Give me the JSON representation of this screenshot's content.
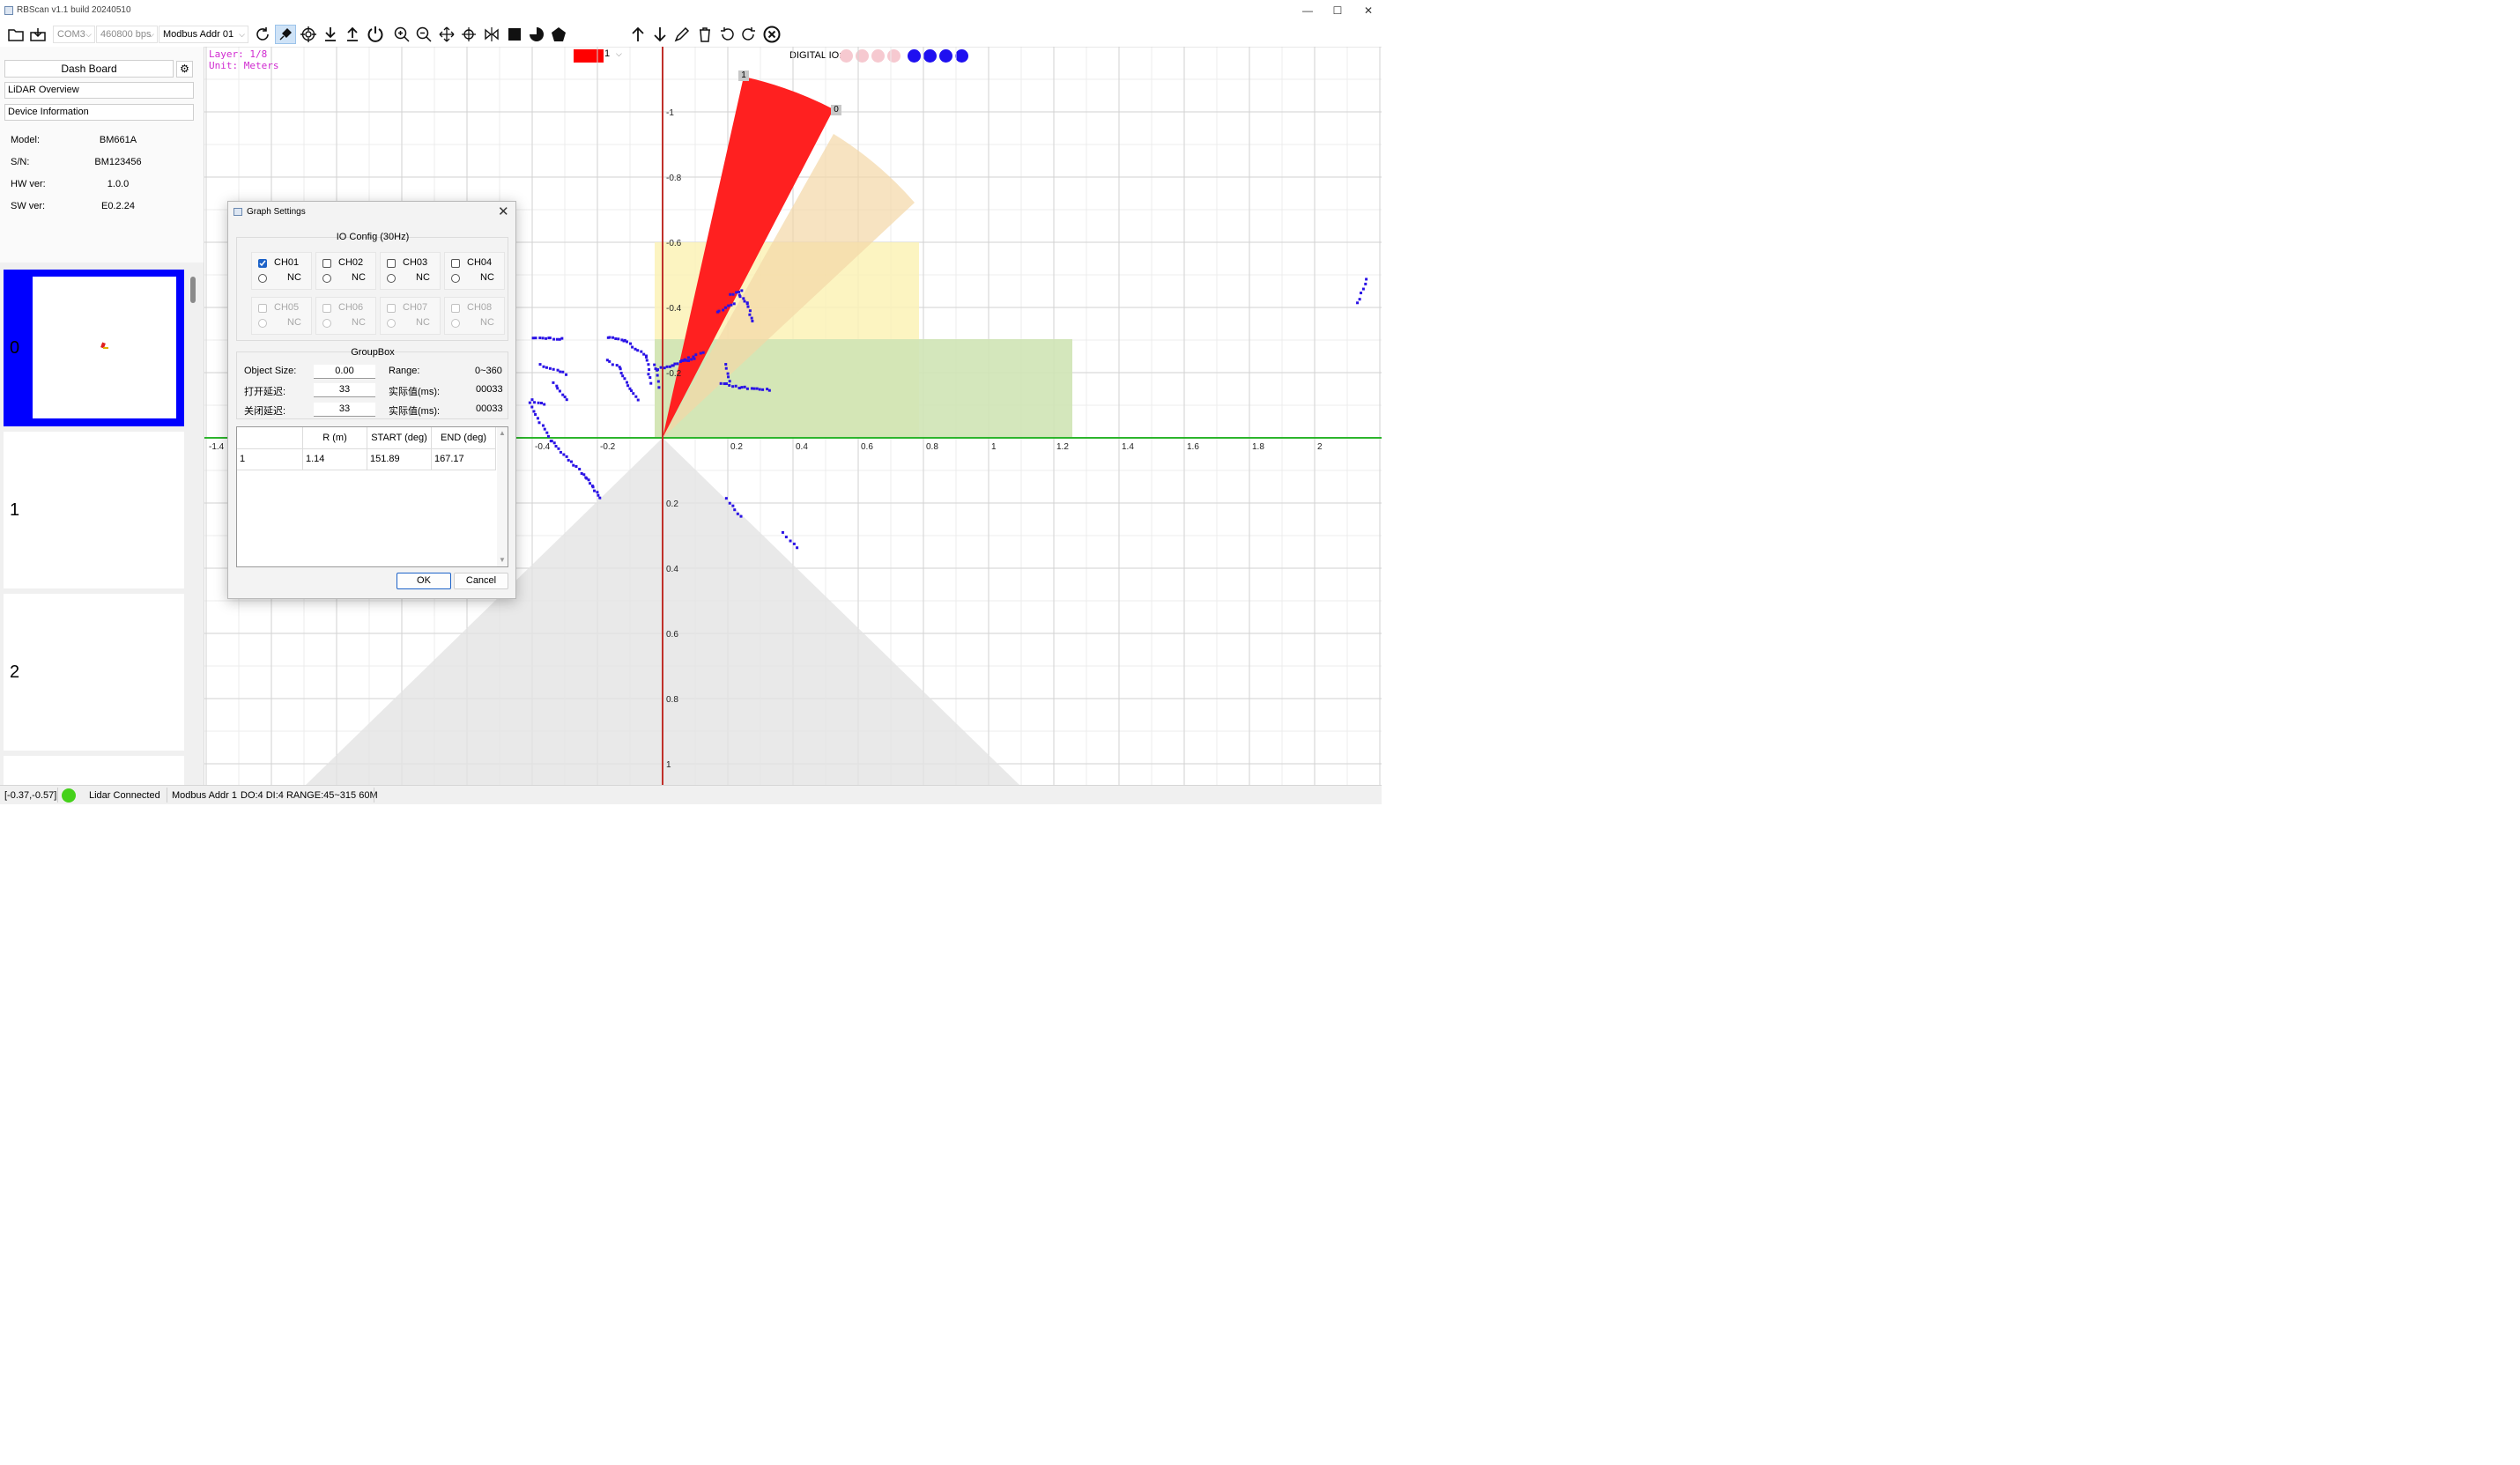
{
  "window": {
    "title": "RBScan v1.1 build 20240510",
    "minimize": "—",
    "maximize": "☐",
    "close": "✕"
  },
  "toolbar": {
    "com_port": "COM3",
    "baud_rate": "460800 bps",
    "modbus_addr": "Modbus Addr 01",
    "color_select_value": "1",
    "digital_io_label": "DIGITAL IO:",
    "digital_io_leds": [
      "off",
      "off",
      "off",
      "off",
      "on",
      "on",
      "on",
      "on"
    ],
    "colors": {
      "led_off": "#f6c9d0",
      "led_on": "#1f10f0",
      "swatch": "#ff0000",
      "accent": "#1c62c8"
    }
  },
  "sidebar": {
    "dashboard": "Dash Board",
    "lidar_overview": "LiDAR Overview",
    "device_info": "Device Information",
    "info": [
      {
        "label": "Model:",
        "value": "BM661A"
      },
      {
        "label": "S/N:",
        "value": "BM123456"
      },
      {
        "label": "HW ver:",
        "value": "1.0.0"
      },
      {
        "label": "SW ver:",
        "value": "E0.2.24"
      }
    ],
    "layers": [
      "0",
      "1",
      "2"
    ]
  },
  "canvas": {
    "layer_label": "Layer: 1/8",
    "unit_label": "Unit: Meters",
    "zone_label_1": "1",
    "zone_label_0": "0",
    "x_ticks": [
      "-1.4",
      "-0.4",
      "-0.2",
      "0.2",
      "0.4",
      "0.6",
      "0.8",
      "1",
      "1.2",
      "1.4",
      "1.6",
      "1.8",
      "2"
    ],
    "y_ticks": [
      "-1",
      "-0.8",
      "-0.6",
      "-0.4",
      "-0.2",
      "0.2",
      "0.4",
      "0.6",
      "0.8",
      "1"
    ],
    "colors": {
      "axis_x": "#2db52d",
      "axis_y": "#c0302a",
      "points": "#2a12e6",
      "zone_red": "#ff2020"
    }
  },
  "dialog": {
    "title": "Graph Settings",
    "io_group_title": "IO Config (30Hz)",
    "channels": [
      {
        "name": "CH01",
        "mode": "NC",
        "checked": true,
        "enabled": true
      },
      {
        "name": "CH02",
        "mode": "NC",
        "checked": false,
        "enabled": true
      },
      {
        "name": "CH03",
        "mode": "NC",
        "checked": false,
        "enabled": true
      },
      {
        "name": "CH04",
        "mode": "NC",
        "checked": false,
        "enabled": true
      },
      {
        "name": "CH05",
        "mode": "NC",
        "checked": false,
        "enabled": false
      },
      {
        "name": "CH06",
        "mode": "NC",
        "checked": false,
        "enabled": false
      },
      {
        "name": "CH07",
        "mode": "NC",
        "checked": false,
        "enabled": false
      },
      {
        "name": "CH08",
        "mode": "NC",
        "checked": false,
        "enabled": false
      }
    ],
    "groupbox_title": "GroupBox",
    "object_size_label": "Object Size:",
    "object_size_value": "0.00",
    "range_label": "Range:",
    "range_value": "0~360",
    "open_delay_label": "打开延迟:",
    "open_delay_value": "33",
    "open_actual_label": "实际值(ms):",
    "open_actual_value": "00033",
    "close_delay_label": "关闭延迟:",
    "close_delay_value": "33",
    "close_actual_label": "实际值(ms):",
    "close_actual_value": "00033",
    "table": {
      "headers": [
        "",
        "R (m)",
        "START (deg)",
        "END (deg)"
      ],
      "rows": [
        [
          "1",
          "1.14",
          "151.89",
          "167.17"
        ]
      ]
    },
    "ok": "OK",
    "cancel": "Cancel"
  },
  "statusbar": {
    "cursor": "[-0.37,-0.57]",
    "connection": "Lidar Connected",
    "modbus": "Modbus Addr 1",
    "io_info": "DO:4 DI:4 RANGE:45~315 60M",
    "connection_color": "#45d11a"
  }
}
